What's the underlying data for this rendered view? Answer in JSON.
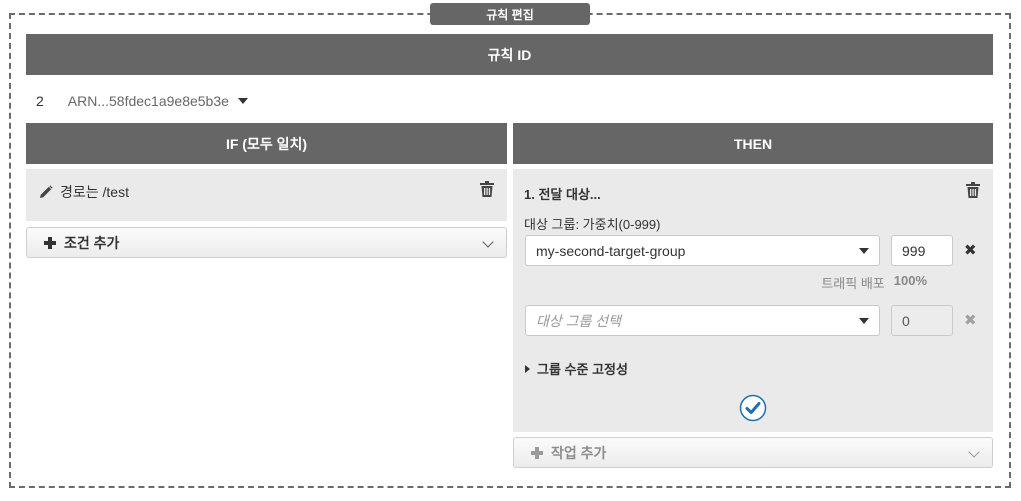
{
  "editor": {
    "tab_label": "규칙 편집"
  },
  "rule": {
    "header": "규칙 ID",
    "number": "2",
    "arn": "ARN...58fdec1a9e8e5b3e"
  },
  "conditions": {
    "header": "IF (모두 일치)",
    "items": [
      {
        "text": "경로는 /test"
      }
    ],
    "add_label": "조건 추가"
  },
  "actions": {
    "header": "THEN",
    "items": [
      {
        "title": "1. 전달 대상...",
        "target_group_label": "대상 그룹: 가중치(0-999)",
        "groups": [
          {
            "name": "my-second-target-group",
            "weight": "999",
            "traffic_label": "트래픽 배포",
            "traffic_pct": "100%"
          },
          {
            "placeholder": "대상 그룹 선택",
            "weight": "0"
          }
        ],
        "stickiness_label": "그룹 수준 고정성"
      }
    ],
    "add_label": "작업 추가"
  },
  "colors": {
    "header_bg": "#666666",
    "panel_bg": "#eaeaea",
    "confirm": "#1f6fb5"
  }
}
